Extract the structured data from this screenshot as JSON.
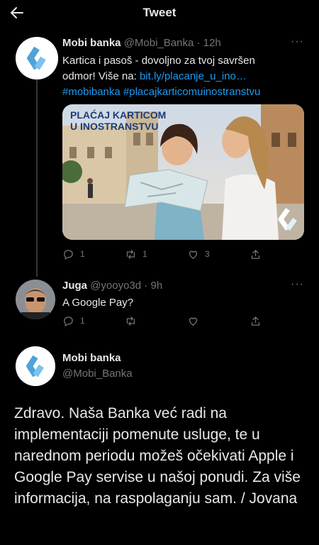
{
  "header": {
    "title": "Tweet"
  },
  "tweet1": {
    "name": "Mobi banka",
    "handle": "@Mobi_Banka",
    "time": "12h",
    "more": "···",
    "text_line1": "Kartica i pasoš - dovoljno za tvoj savršen",
    "text_line2_prefix": "odmor! Više na: ",
    "link": "bit.ly/placanje_u_ino…",
    "hashtags": "#mobibanka #placajkarticomuinostranstvu",
    "media_caption_line1": "PLAĆAJ KARTICOM",
    "media_caption_line2": "U INOSTRANSTVU",
    "replies": "1",
    "retweets": "1",
    "likes": "3"
  },
  "tweet2": {
    "name": "Juga",
    "handle": "@yooyo3d",
    "time": "9h",
    "more": "···",
    "text": "A Google Pay?",
    "replies": "1"
  },
  "tweet3": {
    "name": "Mobi banka",
    "handle": "@Mobi_Banka",
    "text": "Zdravo. Naša Banka već radi na implementaciji pomenute usluge, te u narednom periodu možeš očekivati Apple i Google Pay servise u našoj ponudi. Za više informacija, na raspolaganju sam. / Jovana"
  },
  "colors": {
    "background": "#000000",
    "accent": "#1d9bf0",
    "muted": "#71767b",
    "text": "#e7e9ea"
  },
  "icons": [
    "back-arrow-icon",
    "reply-icon",
    "retweet-icon",
    "like-icon",
    "share-icon",
    "mobi-banka-logo"
  ]
}
